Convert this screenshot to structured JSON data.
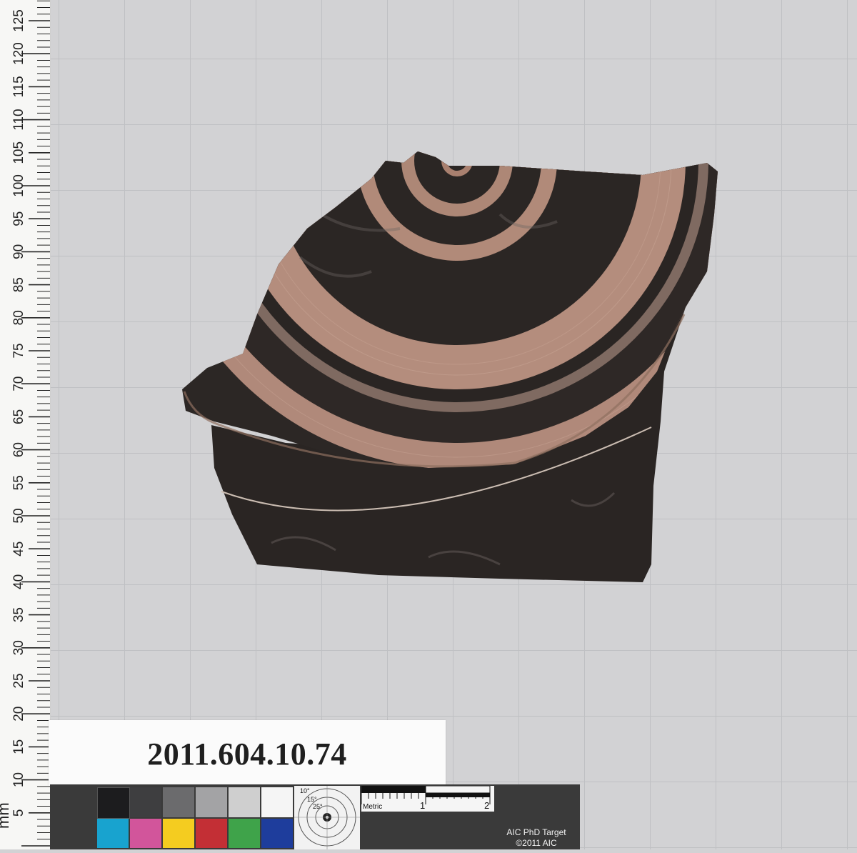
{
  "ruler": {
    "unit_label": "mm",
    "numbers": [
      "125",
      "120",
      "115",
      "110",
      "105",
      "100",
      "95",
      "90",
      "85",
      "80",
      "75",
      "70",
      "65",
      "60",
      "55",
      "50",
      "45",
      "40",
      "35",
      "30",
      "25",
      "20",
      "15",
      "10",
      "5"
    ]
  },
  "label_card": {
    "accession_number": "2011.604.10.74"
  },
  "color_target": {
    "metric_label": "Metric",
    "scale_1": "1",
    "scale_2": "2",
    "angle_10": "10°",
    "angle_15": "15°",
    "angle_25": "25°",
    "name": "AIC PhD Target",
    "copyright": "©2011 AIC",
    "swatch_colors_top": [
      "#1c1c1e",
      "#3e3e40",
      "#6b6b6d",
      "#a3a3a5",
      "#cfcfcf",
      "#f5f5f5"
    ],
    "swatch_colors_bottom": [
      "#18a3cf",
      "#d2559b",
      "#f4cc20",
      "#c32f35",
      "#3fa34a",
      "#1e3d9c"
    ]
  },
  "colors": {
    "background": "#d2d2d4",
    "shard_black": "#2a2523",
    "shard_clay": "#b58a74"
  }
}
